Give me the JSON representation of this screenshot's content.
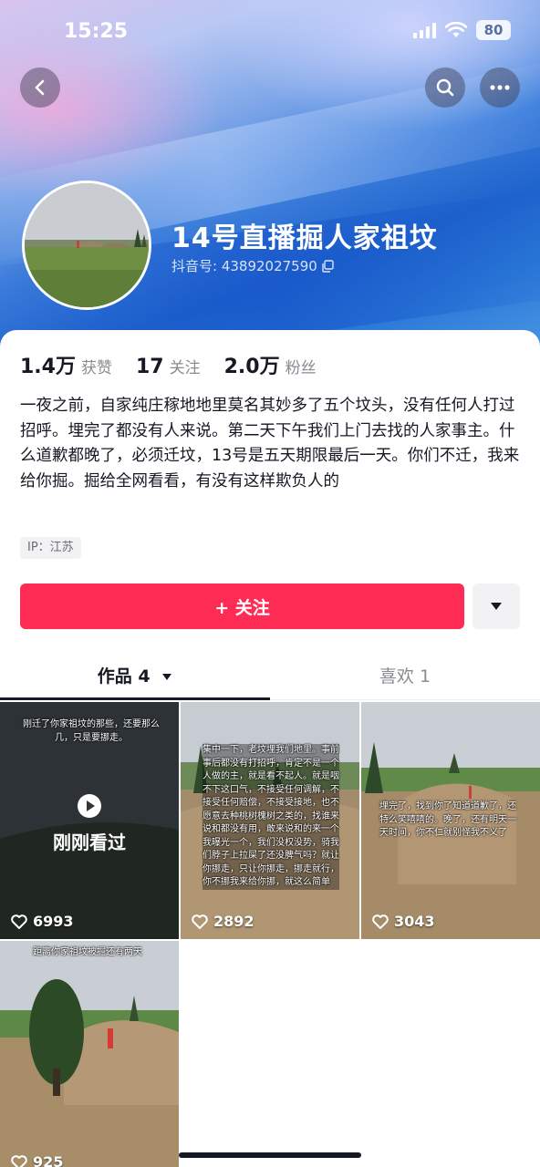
{
  "status_bar": {
    "time": "15:25",
    "battery": "80"
  },
  "header_actions": {
    "back": "back-icon",
    "search": "search-icon",
    "more": "more-icon"
  },
  "profile": {
    "nickname": "14号直播掘人家祖坟",
    "douyin_id": "抖音号: 43892027590",
    "ip": "IP：江苏",
    "bio": "一夜之前，自家纯庄稼地地里莫名其妙多了五个坟头，没有任何人打过招呼。埋完了都没有人来说。第二天下午我们上门去找的人家事主。什么道歉都晚了，必须迁坟，13号是五天期限最后一天。你们不迁，我来给你掘。掘给全网看看，有没有这样欺负人的"
  },
  "stats": [
    {
      "value": "1.4万",
      "label": "获赞"
    },
    {
      "value": "17",
      "label": "关注"
    },
    {
      "value": "2.0万",
      "label": "粉丝"
    }
  ],
  "follow_button": {
    "label": "+ 关注",
    "color": "#fe2c55"
  },
  "tabs": {
    "works": "作品 4",
    "likes": "喜欢 1"
  },
  "videos": [
    {
      "likes": "6993",
      "badge": "刚刚看过",
      "caption": "刚迁了你家祖坟的那些，还要那么几，只是要挪走。"
    },
    {
      "likes": "2892",
      "caption": "集中一下，老坟埋我们地里。事前事后都没有打招呼，肯定不是一个人做的主，就是看不起人。就是咽不下这口气，不接受任何调解，不接受任何赔偿，不接受接地，也不愿意去种桃树槐树之类的，找谁来说和都没有用，敢来说和的来一个我曝光一个，我们没权没势，骑我们脖子上拉屎了还没脾气吗？就让你挪走，只让你挪走，挪走就行，你不挪我来给你挪，就这么简单"
    },
    {
      "likes": "3043",
      "caption": "埋完了，找到你了知道道歉了，还特么笑嘻嘻的。晚了，还有明天一天时间，你不仁就别怪我不义了"
    },
    {
      "likes": "925",
      "caption": "距离你家祖坟被掘还有两天"
    }
  ]
}
